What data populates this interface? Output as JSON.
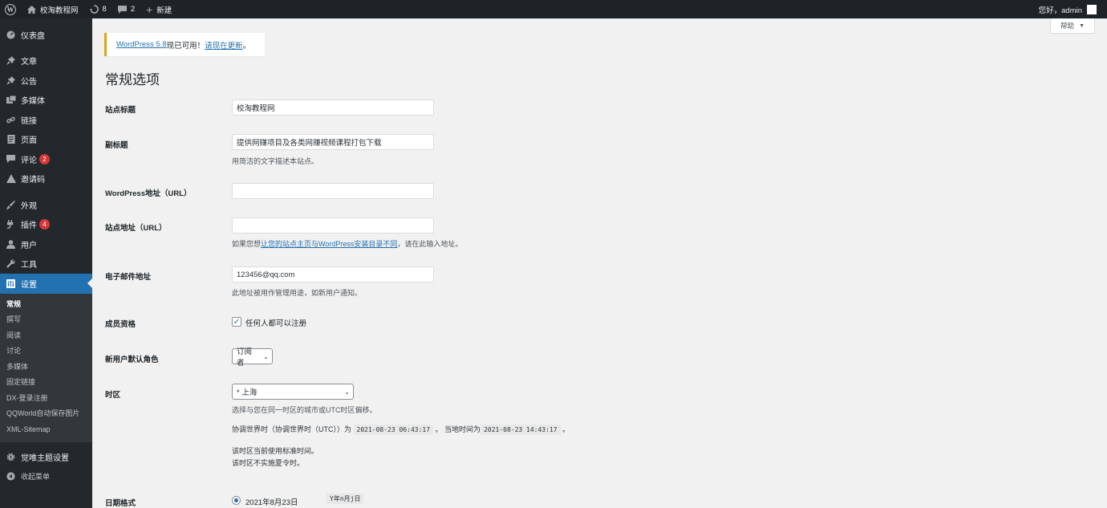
{
  "adminbar": {
    "wp_logo": "W",
    "site_name": "校淘教程网",
    "updates_count": "8",
    "comments_count": "2",
    "new_label": "新建",
    "greeting": "您好，admin"
  },
  "sidebar": {
    "items": [
      {
        "label": "仪表盘",
        "icon": "dashboard-icon"
      },
      {
        "label": "文章",
        "icon": "pin-icon"
      },
      {
        "label": "公告",
        "icon": "pin-icon"
      },
      {
        "label": "多媒体",
        "icon": "media-icon"
      },
      {
        "label": "链接",
        "icon": "link-icon"
      },
      {
        "label": "页面",
        "icon": "page-icon"
      },
      {
        "label": "评论",
        "icon": "comment-icon",
        "badge": "2"
      },
      {
        "label": "邀请码",
        "icon": "invite-icon"
      },
      {
        "label": "外观",
        "icon": "brush-icon"
      },
      {
        "label": "插件",
        "icon": "plugin-icon",
        "badge": "4"
      },
      {
        "label": "用户",
        "icon": "user-icon"
      },
      {
        "label": "工具",
        "icon": "wrench-icon"
      },
      {
        "label": "设置",
        "icon": "settings-icon"
      }
    ],
    "submenu": [
      "常规",
      "撰写",
      "阅读",
      "讨论",
      "多媒体",
      "固定链接",
      "DX-登录注册",
      "QQWorld自动保存图片",
      "XML-Sitemap"
    ],
    "theme_settings": "觉唯主题设置",
    "collapse": "收起菜单"
  },
  "help_tab": "帮助",
  "notice": {
    "link1": "WordPress 5.8",
    "text": "现已可用！",
    "link2": "请现在更新",
    "end": "。"
  },
  "page_title": "常规选项",
  "form": {
    "site_title_label": "站点标题",
    "site_title_value": "校淘教程网",
    "tagline_label": "副标题",
    "tagline_value": "提供网赚项目及各类网赚视频课程打包下载",
    "tagline_desc": "用简洁的文字描述本站点。",
    "wp_url_label": "WordPress地址（URL）",
    "wp_url_value": "",
    "site_url_label": "站点地址（URL）",
    "site_url_value": "",
    "site_url_desc_pre": "如果您想",
    "site_url_desc_link": "让您的站点主页与WordPress安装目录不同",
    "site_url_desc_post": "，请在此输入地址。",
    "email_label": "电子邮件地址",
    "email_value": "123456@qq.com",
    "email_desc": "此地址被用作管理用途，如新用户通知。",
    "membership_label": "成员资格",
    "membership_check": "任何人都可以注册",
    "role_label": "新用户默认角色",
    "role_value": "订阅者",
    "timezone_label": "时区",
    "timezone_value": "* 上海",
    "timezone_desc": "选择与您在同一时区的城市或UTC时区偏移。",
    "utc_pre": "协调世界时（协调世界时（UTC））为",
    "utc_time": "2021-08-23 06:43:17",
    "local_pre": "。 当地时间为",
    "local_time": "2021-08-23 14:43:17",
    "local_post": "。",
    "tz_note1": "该时区当前使用标准时间。",
    "tz_note2": "该时区不实施夏令时。",
    "date_format_label": "日期格式",
    "date_format_option": "2021年8月23日",
    "date_format_code": "Y年n月j日"
  }
}
